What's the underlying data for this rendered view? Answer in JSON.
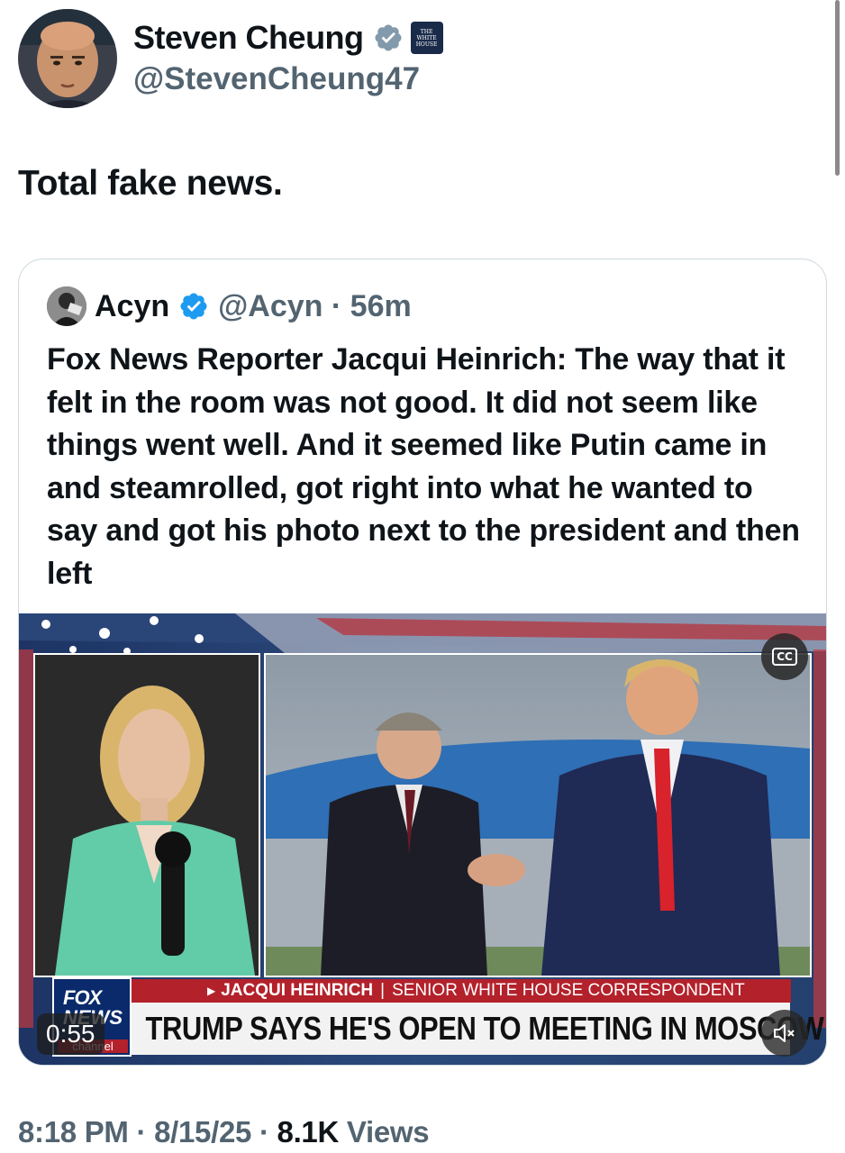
{
  "tweet": {
    "author": {
      "display_name": "Steven Cheung",
      "handle": "@StevenCheung47",
      "verified_color": "#829aab",
      "affiliation_badge": "THE WHITE HOUSE"
    },
    "text": "Total fake news.",
    "quote": {
      "author": {
        "display_name": "Acyn",
        "handle": "@Acyn",
        "separator": "·",
        "time": "56m",
        "verified_color": "#1d9bf0"
      },
      "text": "Fox News Reporter Jacqui Heinrich: The way that it felt in the room was not good. It did not seem like things went well. And it seemed like Putin came in and steamrolled, got right into what he wanted to say and got his photo next to the president and then left",
      "video": {
        "duration": "0:55",
        "cc_label": "CC",
        "lower_third": {
          "name": "JACQUI HEINRICH",
          "separator": "|",
          "title": "SENIOR WHITE HOUSE CORRESPONDENT",
          "headline": "TRUMP SAYS HE'S OPEN TO MEETING IN MOSCOW"
        },
        "network_logo": {
          "line1": "FOX",
          "line2": "NEWS",
          "line3": "channel"
        }
      }
    },
    "meta": {
      "time": "8:18 PM",
      "sep1": " · ",
      "date": "8/15/25",
      "sep2": " · ",
      "views_count": "8.1K",
      "views_label": " Views"
    }
  }
}
